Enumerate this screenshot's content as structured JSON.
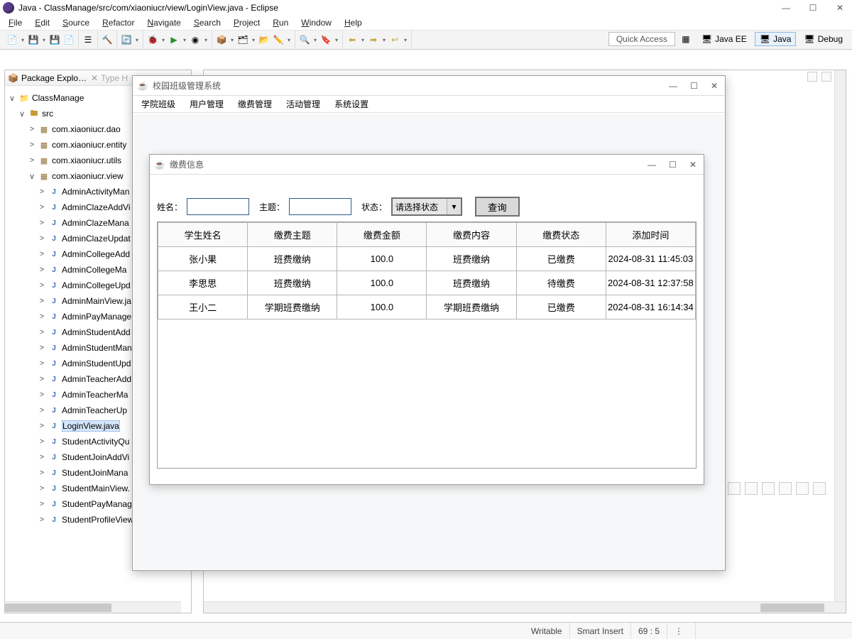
{
  "window": {
    "title": "Java - ClassManage/src/com/xiaoniucr/view/LoginView.java - Eclipse",
    "controls": {
      "min": "—",
      "max": "☐",
      "close": "✕"
    }
  },
  "menubar": [
    "File",
    "Edit",
    "Source",
    "Refactor",
    "Navigate",
    "Search",
    "Project",
    "Run",
    "Window",
    "Help"
  ],
  "toolbar_right": {
    "quick_access": "Quick Access",
    "perspectives": [
      {
        "label": "Java EE",
        "active": false
      },
      {
        "label": "Java",
        "active": true
      },
      {
        "label": "Debug",
        "active": false
      }
    ]
  },
  "explorer": {
    "tab_label": "Package Explo…",
    "ghost_tab": "Type H",
    "project": "ClassManage",
    "src": "src",
    "packages": [
      "com.xiaoniucr.dao",
      "com.xiaoniucr.entity",
      "com.xiaoniucr.utils",
      "com.xiaoniucr.view"
    ],
    "files": [
      "AdminActivityMan",
      "AdminClazeAddVi",
      "AdminClazeMana",
      "AdminClazeUpdat",
      "AdminCollegeAdd",
      "AdminCollegeMa",
      "AdminCollegeUpd",
      "AdminMainView.ja",
      "AdminPayManage",
      "AdminStudentAdd",
      "AdminStudentMan",
      "AdminStudentUpd",
      "AdminTeacherAdd",
      "AdminTeacherMa",
      "AdminTeacherUp",
      "LoginView.java",
      "StudentActivityQu",
      "StudentJoinAddVi",
      "StudentJoinMana",
      "StudentMainView.",
      "StudentPayManageView.java",
      "StudentProfileView.java"
    ],
    "selected_file": "LoginView.java"
  },
  "mdi": {
    "title": "校园班级管理系统",
    "menus": [
      "学院班级",
      "用户管理",
      "缴费管理",
      "活动管理",
      "系统设置"
    ]
  },
  "inner": {
    "title": "缴费信息",
    "filters": {
      "name_label": "姓名：",
      "name_value": "",
      "topic_label": "主题：",
      "topic_value": "",
      "status_label": "状态：",
      "status_selected": "请选择状态",
      "query_button": "查询"
    },
    "table": {
      "headers": [
        "学生姓名",
        "缴费主题",
        "缴费金额",
        "缴费内容",
        "缴费状态",
        "添加时间"
      ],
      "rows": [
        [
          "张小果",
          "班费缴纳",
          "100.0",
          "班费缴纳",
          "已缴费",
          "2024-08-31 11:45:03"
        ],
        [
          "李思思",
          "班费缴纳",
          "100.0",
          "班费缴纳",
          "待缴费",
          "2024-08-31 12:37:58"
        ],
        [
          "王小二",
          "学期班费缴纳",
          "100.0",
          "学期班费缴纳",
          "已缴费",
          "2024-08-31 16:14:34"
        ]
      ]
    }
  },
  "statusbar": {
    "writable": "Writable",
    "insert": "Smart Insert",
    "caret": "69 : 5"
  }
}
